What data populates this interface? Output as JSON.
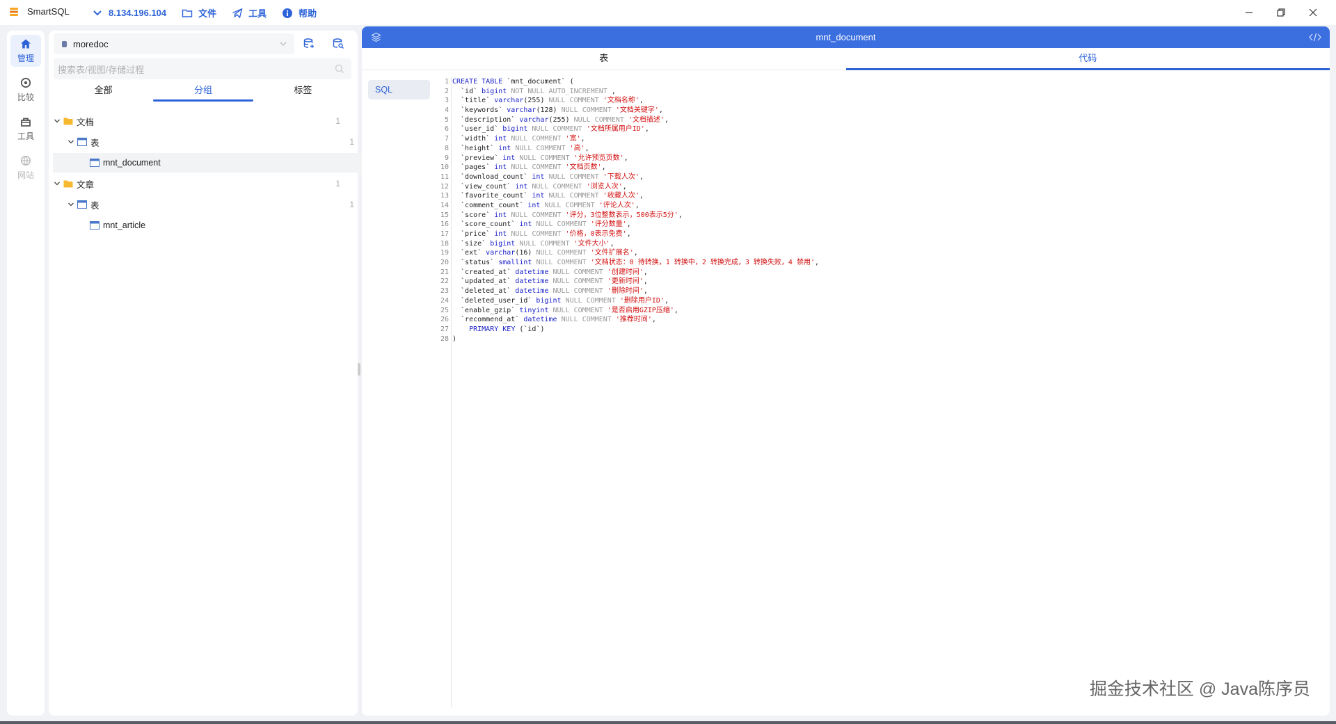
{
  "app": {
    "title": "SmartSQL"
  },
  "menu": {
    "host": "8.134.196.104",
    "file": "文件",
    "tools": "工具",
    "help": "帮助"
  },
  "rail": [
    {
      "label": "管理",
      "icon": "home-icon"
    },
    {
      "label": "比较",
      "icon": "compare-icon"
    },
    {
      "label": "工具",
      "icon": "toolbox-icon"
    },
    {
      "label": "网站",
      "icon": "globe-icon"
    }
  ],
  "nav": {
    "database": "moredoc",
    "search_placeholder": "搜索表/视图/存储过程",
    "tabs": [
      "全部",
      "分组",
      "标签"
    ],
    "tree": [
      {
        "label": "文档",
        "count": "1"
      },
      {
        "label": "表",
        "count": "1"
      },
      {
        "label": "mnt_document",
        "count": ""
      },
      {
        "label": "文章",
        "count": "1"
      },
      {
        "label": "表",
        "count": "1"
      },
      {
        "label": "mnt_article",
        "count": ""
      }
    ]
  },
  "main": {
    "title": "mnt_document",
    "tabs": [
      "表",
      "代码"
    ],
    "language": "SQL"
  },
  "code_lines": [
    "CREATE TABLE `mnt_document` (",
    "  `id` bigint NOT NULL AUTO_INCREMENT ,",
    "  `title` varchar(255) NULL COMMENT '文档名称',",
    "  `keywords` varchar(128) NULL COMMENT '文档关键字',",
    "  `description` varchar(255) NULL COMMENT '文档描述',",
    "  `user_id` bigint NULL COMMENT '文档所属用户ID',",
    "  `width` int NULL COMMENT '宽',",
    "  `height` int NULL COMMENT '高',",
    "  `preview` int NULL COMMENT '允许预览页数',",
    "  `pages` int NULL COMMENT '文档页数',",
    "  `download_count` int NULL COMMENT '下载人次',",
    "  `view_count` int NULL COMMENT '浏览人次',",
    "  `favorite_count` int NULL COMMENT '收藏人次',",
    "  `comment_count` int NULL COMMENT '评论人次',",
    "  `score` int NULL COMMENT '评分，3位整数表示，500表示5分',",
    "  `score_count` int NULL COMMENT '评分数量',",
    "  `price` int NULL COMMENT '价格，0表示免费',",
    "  `size` bigint NULL COMMENT '文件大小',",
    "  `ext` varchar(16) NULL COMMENT '文件扩展名',",
    "  `status` smallint NULL COMMENT '文档状态：0 待转换，1 转换中，2 转换完成，3 转换失败，4 禁用',",
    "  `created_at` datetime NULL COMMENT '创建时间',",
    "  `updated_at` datetime NULL COMMENT '更新时间',",
    "  `deleted_at` datetime NULL COMMENT '删除时间',",
    "  `deleted_user_id` bigint NULL COMMENT '删除用户ID',",
    "  `enable_gzip` tinyint NULL COMMENT '是否启用GZIP压缩',",
    "  `recommend_at` datetime NULL COMMENT '推荐时间',",
    "    PRIMARY KEY (`id`)",
    ")"
  ],
  "watermark": "掘金技术社区 @ Java陈序员",
  "colors": {
    "accent": "#2d63d8",
    "header": "#3b6fe0",
    "keyword": "#1b22c9",
    "string": "#d21010"
  }
}
